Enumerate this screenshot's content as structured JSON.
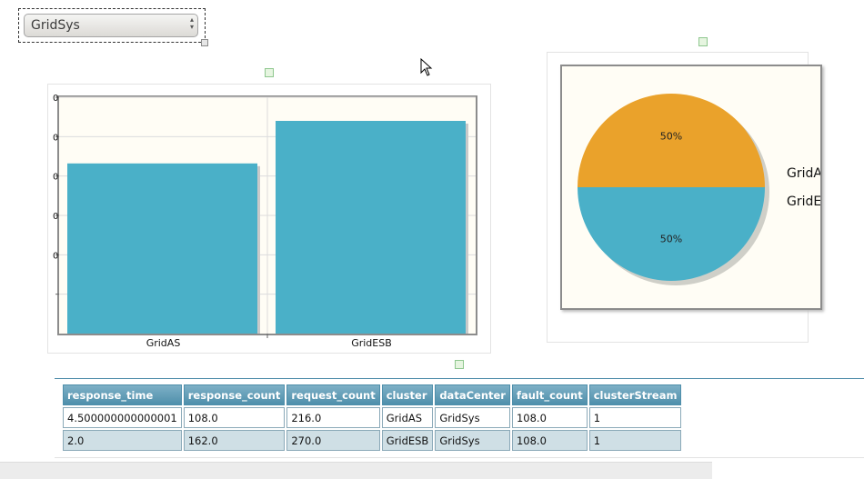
{
  "dropdown": {
    "selected": "GridSys"
  },
  "bar_chart": {
    "y_tick_labels": [
      "0",
      "0",
      "0",
      "0",
      "0"
    ],
    "bar_color": "#4ab0c8"
  },
  "pie_chart": {
    "colors": [
      "#eaa22b",
      "#4ab0c8"
    ]
  },
  "chart_data": [
    {
      "type": "bar",
      "categories": [
        "GridAS",
        "GridESB"
      ],
      "values": [
        216.0,
        270.0
      ],
      "ylim": [
        0,
        300
      ]
    },
    {
      "type": "pie",
      "labels": [
        "GridAS",
        "GridESB"
      ],
      "values": [
        50,
        50
      ],
      "value_labels": [
        "50%",
        "50%"
      ],
      "legend_position": "right"
    }
  ],
  "table": {
    "columns": [
      "response_time",
      "response_count",
      "request_count",
      "cluster",
      "dataCenter",
      "fault_count",
      "clusterStream"
    ],
    "rows": [
      [
        "4.500000000000001",
        "108.0",
        "216.0",
        "GridAS",
        "GridSys",
        "108.0",
        "1"
      ],
      [
        "2.0",
        "162.0",
        "270.0",
        "GridESB",
        "GridSys",
        "108.0",
        "1"
      ]
    ]
  }
}
